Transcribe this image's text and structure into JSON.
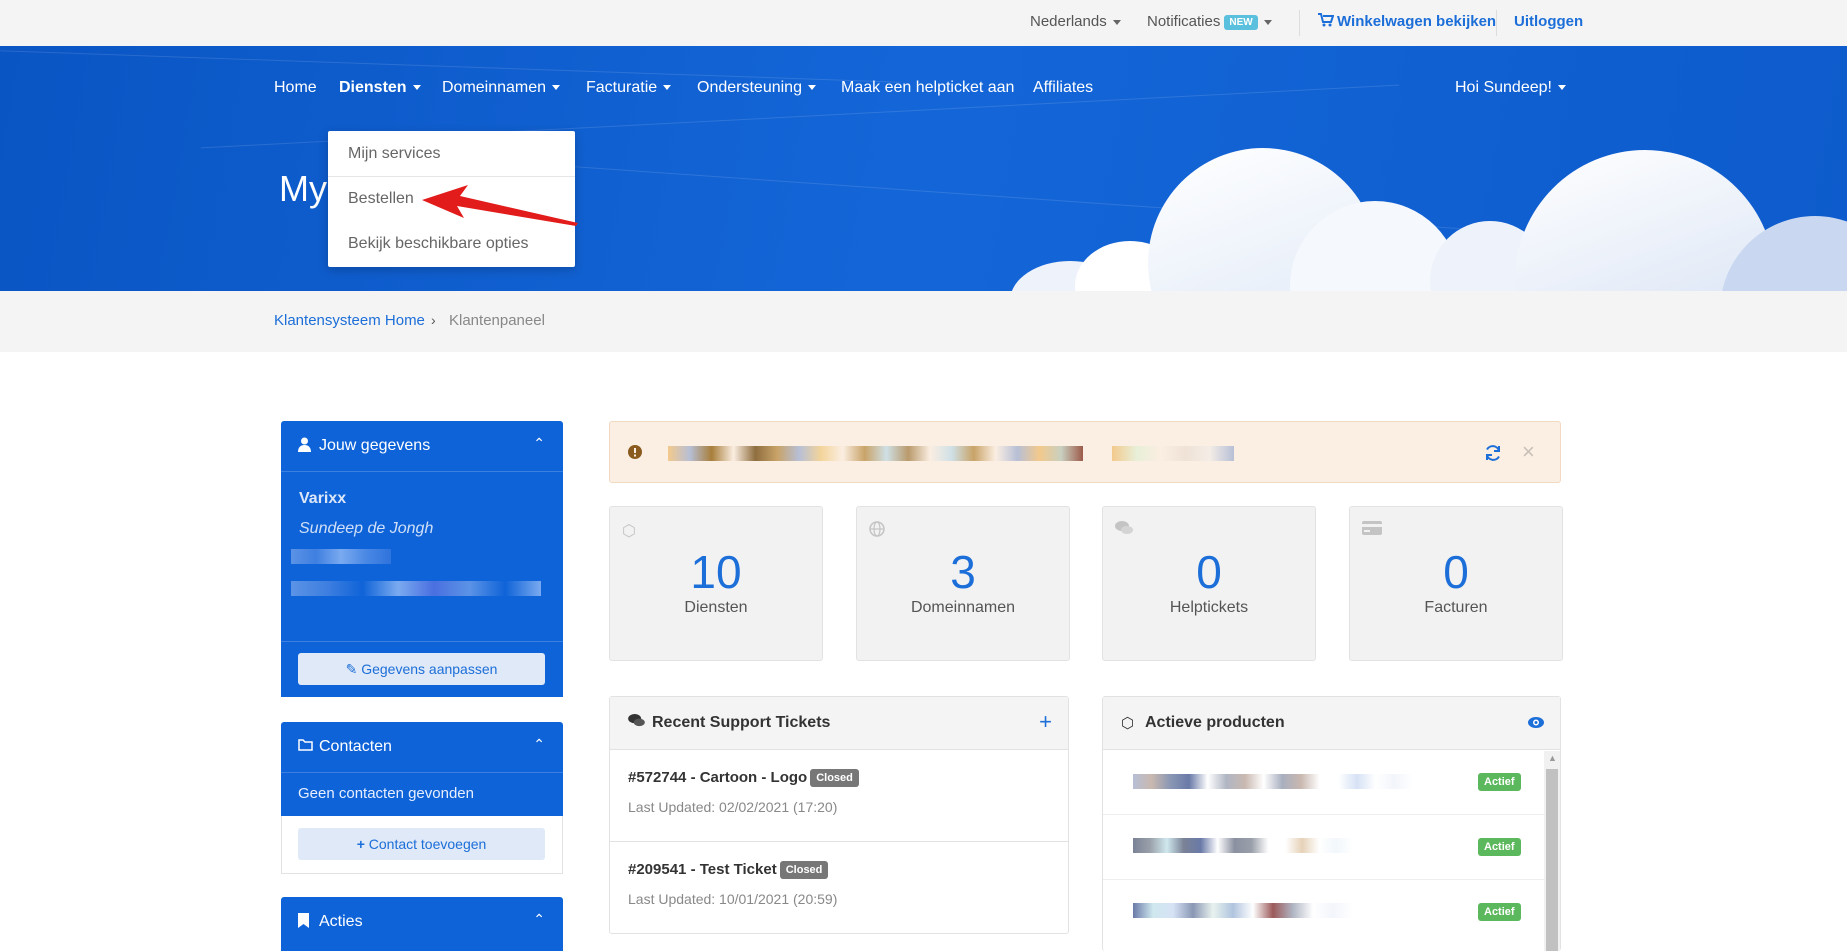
{
  "topbar": {
    "language": "Nederlands",
    "notifications": "Notificaties",
    "new_badge": "NEW",
    "cart": "Winkelwagen bekijken",
    "logout": "Uitloggen"
  },
  "nav": {
    "items": [
      "Home",
      "Diensten",
      "Domeinnamen",
      "Facturatie",
      "Ondersteuning",
      "Maak een helpticket aan",
      "Affiliates"
    ],
    "greeting": "Hoi Sundeep!"
  },
  "page_heading": "My",
  "dropdown": {
    "items": [
      "Mijn services",
      "Bestellen",
      "Bekijk beschikbare opties"
    ]
  },
  "breadcrumb": {
    "home": "Klantensysteem Home",
    "current": "Klantenpaneel"
  },
  "sidebar": {
    "details": {
      "title": "Jouw gegevens",
      "company": "Varixx",
      "name": "Sundeep de Jongh",
      "button": "Gegevens aanpassen"
    },
    "contacts": {
      "title": "Contacten",
      "empty": "Geen contacten gevonden",
      "button": "Contact toevoegen"
    },
    "actions": {
      "title": "Acties"
    }
  },
  "stats": [
    {
      "value": "10",
      "label": "Diensten"
    },
    {
      "value": "3",
      "label": "Domeinnamen"
    },
    {
      "value": "0",
      "label": "Helptickets"
    },
    {
      "value": "0",
      "label": "Facturen"
    }
  ],
  "tickets": {
    "title": "Recent Support Tickets",
    "items": [
      {
        "title": "#572744 - Cartoon - Logo",
        "status": "Closed",
        "updated": "Last Updated: 02/02/2021 (17:20)"
      },
      {
        "title": "#209541 - Test Ticket",
        "status": "Closed",
        "updated": "Last Updated: 10/01/2021 (20:59)"
      }
    ]
  },
  "products": {
    "title": "Actieve producten",
    "items": [
      {
        "status": "Actief"
      },
      {
        "status": "Actief"
      },
      {
        "status": "Actief"
      }
    ]
  },
  "colors": {
    "brand_blue": "#0f63d8",
    "link_blue": "#1c6ed8",
    "success": "#5cb85c",
    "closed": "#777777",
    "alert_bg": "#fbeee2"
  }
}
